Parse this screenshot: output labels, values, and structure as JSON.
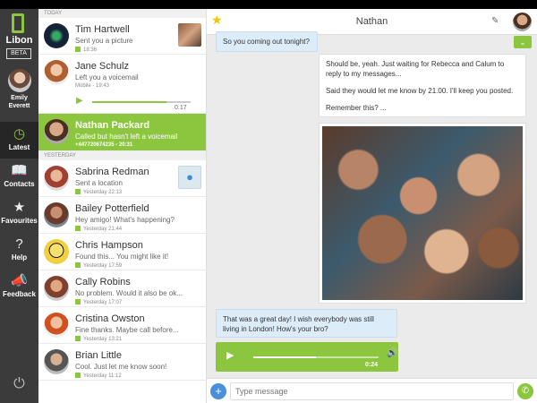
{
  "app": {
    "logo_text": "Libon",
    "beta_label": "BETA"
  },
  "profile": {
    "name_line1": "Emily",
    "name_line2": "Everett"
  },
  "nav": [
    {
      "label": "Latest",
      "icon": "clock-icon"
    },
    {
      "label": "Contacts",
      "icon": "book-icon"
    },
    {
      "label": "Favourites",
      "icon": "star-icon"
    },
    {
      "label": "Help",
      "icon": "question-icon"
    },
    {
      "label": "Feedback",
      "icon": "megaphone-icon"
    }
  ],
  "colors": {
    "accent": "#8cc63f",
    "nav_bg": "#3b3b3b",
    "incoming_bubble": "#dcecf8"
  },
  "list": {
    "today_label": "TODAY",
    "yesterday_label": "YESTERDAY",
    "items": [
      {
        "first": "Tim",
        "last": "Hartwell",
        "sub": "Sent you a picture",
        "time": "18:36"
      },
      {
        "first": "Jane",
        "last": "Schulz",
        "sub": "Left you a voicemail",
        "time": "Mobile - 19:43"
      },
      {
        "first": "Nathan",
        "last": "Packard",
        "sub": "Called but hasn't left a voicemail",
        "time": "+447720674235 - 20:31"
      },
      {
        "first": "Sabrina",
        "last": "Redman",
        "sub": "Sent a location",
        "time": "Yesterday 22:13"
      },
      {
        "first": "Bailey",
        "last": "Potterfield",
        "sub": "Hey amigo! What's happening?",
        "time": "Yesterday 21:44"
      },
      {
        "first": "Chris",
        "last": "Hampson",
        "sub": "Found this... You might like it!",
        "time": "Yesterday 17:59"
      },
      {
        "first": "Cally",
        "last": "Robins",
        "sub": "No problem. Would it also be ok...",
        "time": "Yesterday 17:07"
      },
      {
        "first": "Cristina",
        "last": "Owston",
        "sub": "Fine thanks. Maybe call before...",
        "time": "Yesterday 13:21"
      },
      {
        "first": "Brian",
        "last": "Little",
        "sub": "Cool. Just let me know soon!",
        "time": "Yesterday 11:12"
      }
    ],
    "voicemail_time": "0.17",
    "voicemail_progress": 0.75
  },
  "chat": {
    "contact": "Nathan",
    "msg1": "So you coming out tonight?",
    "msg2_p1": "Should be, yeah. Just waiting for Rebecca and Calum to reply to my messages...",
    "msg2_p2": "Said they would let me know by 21.00. I'll keep you posted.",
    "msg2_p3": "Remember this? ...",
    "msg3": "That was a great day! I wish everybody was still living in London! How's your bro?",
    "audio_time": "0:24",
    "audio_progress": 0.5,
    "input_placeholder": "Type message"
  }
}
